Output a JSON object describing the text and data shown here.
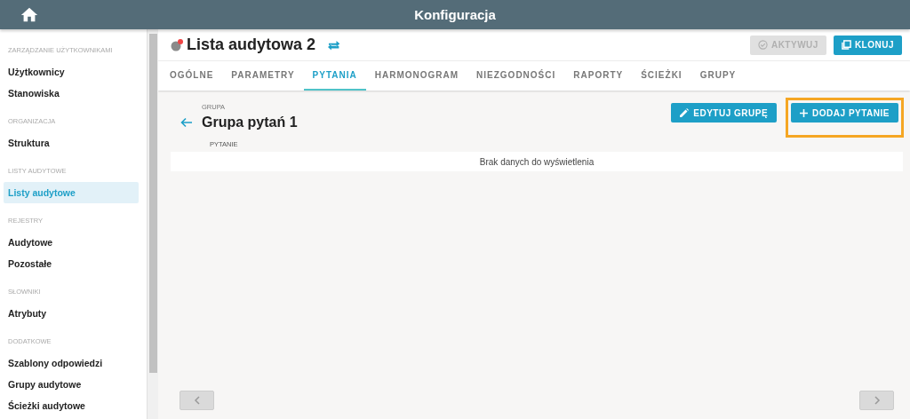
{
  "header": {
    "title": "Konfiguracja"
  },
  "sidebar": {
    "sections": [
      {
        "heading": "ZARZĄDZANIE UŻYTKOWNIKAMI",
        "items": [
          {
            "label": "Użytkownicy",
            "selected": false
          },
          {
            "label": "Stanowiska",
            "selected": false
          }
        ]
      },
      {
        "heading": "ORGANIZACJA",
        "items": [
          {
            "label": "Struktura",
            "selected": false
          }
        ]
      },
      {
        "heading": "LISTY AUDYTOWE",
        "items": [
          {
            "label": "Listy audytowe",
            "selected": true
          }
        ]
      },
      {
        "heading": "REJESTRY",
        "items": [
          {
            "label": "Audytowe",
            "selected": false
          },
          {
            "label": "Pozostałe",
            "selected": false
          }
        ]
      },
      {
        "heading": "SŁOWNIKI",
        "items": [
          {
            "label": "Atrybuty",
            "selected": false
          }
        ]
      },
      {
        "heading": "DODATKOWE",
        "items": [
          {
            "label": "Szablony odpowiedzi",
            "selected": false
          },
          {
            "label": "Grupy audytowe",
            "selected": false
          },
          {
            "label": "Ścieżki audytowe",
            "selected": false
          }
        ]
      }
    ]
  },
  "page": {
    "title": "Lista audytowa 2",
    "flagged": true,
    "actions": [
      {
        "kind": "activate",
        "label": "AKTYWUJ",
        "disabled": true
      },
      {
        "kind": "clone",
        "label": "KLONUJ",
        "disabled": false
      }
    ]
  },
  "tabs": [
    {
      "label": "OGÓLNE",
      "selected": false
    },
    {
      "label": "PARAMETRY",
      "selected": false
    },
    {
      "label": "PYTANIA",
      "selected": true
    },
    {
      "label": "HARMONOGRAM",
      "selected": false
    },
    {
      "label": "NIEZGODNOŚCI",
      "selected": false
    },
    {
      "label": "RAPORTY",
      "selected": false
    },
    {
      "label": "ŚCIEŻKI",
      "selected": false
    },
    {
      "label": "GRUPY",
      "selected": false
    }
  ],
  "group": {
    "caption": "GRUPA",
    "title": "Grupa pytań 1",
    "buttons": [
      {
        "kind": "edit",
        "label": "EDYTUJ GRUPĘ",
        "highlighted": false
      },
      {
        "kind": "add",
        "label": "DODAJ PYTANIE",
        "highlighted": true
      }
    ]
  },
  "table": {
    "columns": [
      "PYTANIE"
    ],
    "empty_text": "Brak danych do wyświetlenia"
  }
}
